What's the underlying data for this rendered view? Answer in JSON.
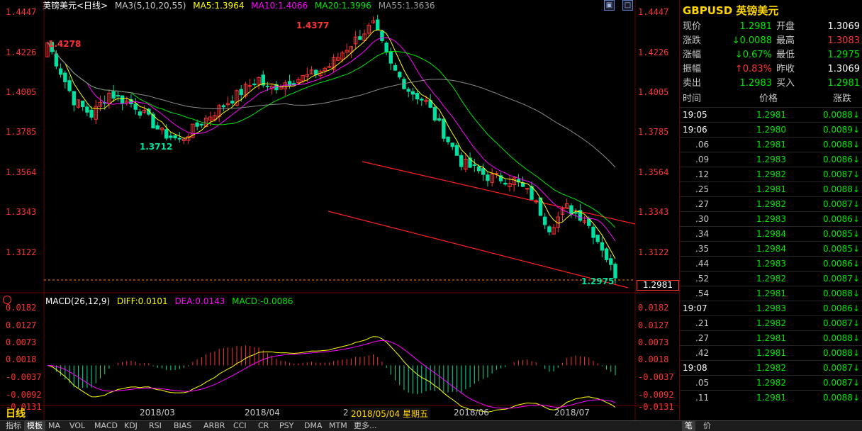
{
  "header": {
    "instrument": "英镑美元<日线>",
    "ma_label": "MA3(5,10,20,55)",
    "ma5": "MA5:1.3964",
    "ma10": "MA10:1.4066",
    "ma20": "MA20:1.3996",
    "ma55": "MA55:1.3636"
  },
  "macd_header": {
    "label": "MACD(26,12,9)",
    "diff": "DIFF:0.0101",
    "dea": "DEA:0.0143",
    "macd": "MACD:-0.0086"
  },
  "price_axis": [
    "1.4447",
    "1.4226",
    "1.4005",
    "1.3785",
    "1.3564",
    "1.3343",
    "1.3122"
  ],
  "macd_axis": [
    "0.0182",
    "0.0127",
    "0.0073",
    "0.0018",
    "-0.0037",
    "-0.0092",
    "-0.0131"
  ],
  "x_labels": [
    "2018/03",
    "2018/04",
    "2018/05/04 星期五",
    "2018/06",
    "2018/07"
  ],
  "x_label_cut": "2",
  "annotations": {
    "high": "1.4377",
    "left_high": "1.4278",
    "left_low": "1.3712",
    "low": "1.2975",
    "current": "1.2981"
  },
  "period_label": "日线",
  "colors": {
    "ma5": "#ffff00",
    "ma10": "#ff00ff",
    "ma20": "#00e600",
    "ma55": "#8a8a8a",
    "up": "#ff3232",
    "down": "#00e0a0"
  },
  "quote": {
    "title": "GBPUSD 英镑美元",
    "rows": [
      {
        "l1": "现价",
        "v1": "1.2981",
        "c1": "green",
        "l2": "开盘",
        "v2": "1.3069",
        "c2": "white"
      },
      {
        "l1": "涨跌",
        "v1": "↓0.0088",
        "c1": "green",
        "l2": "最高",
        "v2": "1.3083",
        "c2": "red"
      },
      {
        "l1": "涨幅",
        "v1": "↓0.67%",
        "c1": "green",
        "l2": "最低",
        "v2": "1.2975",
        "c2": "green"
      },
      {
        "l1": "振幅",
        "v1": "↑0.83%",
        "c1": "red",
        "l2": "昨收",
        "v2": "1.3069",
        "c2": "white"
      },
      {
        "l1": "卖出",
        "v1": "1.2983",
        "c1": "green",
        "l2": "买入",
        "v2": "1.2981",
        "c2": "green"
      }
    ]
  },
  "ticks_header": {
    "time": "时间",
    "price": "价格",
    "chg": "涨跌"
  },
  "ticks": [
    {
      "t": "19:05",
      "p": "1.2981",
      "c": "0.0088↓"
    },
    {
      "t": "19:06",
      "p": "1.2980",
      "c": "0.0089↓"
    },
    {
      "t": ".06",
      "p": "1.2981",
      "c": "0.0088↓"
    },
    {
      "t": ".09",
      "p": "1.2983",
      "c": "0.0086↓"
    },
    {
      "t": ".12",
      "p": "1.2982",
      "c": "0.0087↓"
    },
    {
      "t": ".25",
      "p": "1.2981",
      "c": "0.0088↓"
    },
    {
      "t": ".27",
      "p": "1.2982",
      "c": "0.0087↓"
    },
    {
      "t": ".30",
      "p": "1.2983",
      "c": "0.0086↓"
    },
    {
      "t": ".34",
      "p": "1.2984",
      "c": "0.0085↓"
    },
    {
      "t": ".35",
      "p": "1.2984",
      "c": "0.0085↓"
    },
    {
      "t": ".44",
      "p": "1.2983",
      "c": "0.0086↓"
    },
    {
      "t": ".52",
      "p": "1.2982",
      "c": "0.0087↓"
    },
    {
      "t": ".54",
      "p": "1.2981",
      "c": "0.0088↓"
    },
    {
      "t": "19:07",
      "p": "1.2983",
      "c": "0.0086↓"
    },
    {
      "t": ".21",
      "p": "1.2982",
      "c": "0.0087↓"
    },
    {
      "t": ".27",
      "p": "1.2981",
      "c": "0.0088↓"
    },
    {
      "t": ".42",
      "p": "1.2981",
      "c": "0.0088↓"
    },
    {
      "t": "19:08",
      "p": "1.2982",
      "c": "0.0087↓"
    },
    {
      "t": ".05",
      "p": "1.2982",
      "c": "0.0087↓"
    },
    {
      "t": ".11",
      "p": "1.2981",
      "c": "0.0088↓"
    }
  ],
  "bottom_tabs": [
    "指标",
    "模板",
    "MA",
    "VOL",
    "MACD",
    "KDJ",
    "RSI",
    "BIAS",
    "ARBR",
    "CCI",
    "CR",
    "PSY",
    "DMA",
    "MTM",
    "更多..."
  ],
  "right_tabs": [
    "笔",
    "价"
  ]
}
